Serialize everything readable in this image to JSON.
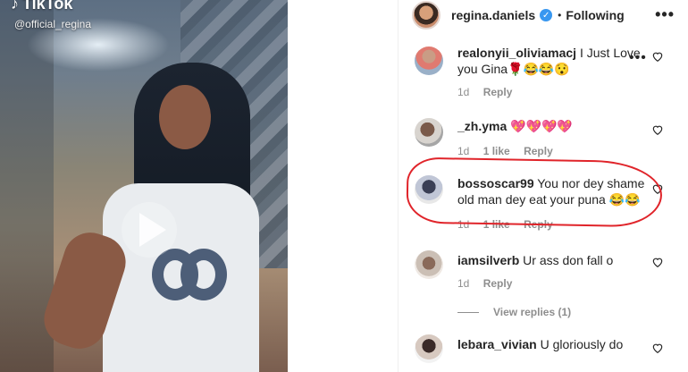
{
  "video": {
    "tiktok_label": "TikTok",
    "tiktok_user": "@official_regina"
  },
  "header": {
    "username": "regina.daniels",
    "separator": "•",
    "follow_status": "Following",
    "more": "•••"
  },
  "comments": [
    {
      "user": "realonyii_oliviamacj",
      "text": "I Just Love you Gina🌹😂😂😯",
      "time": "1d",
      "likes": "",
      "reply": "Reply"
    },
    {
      "user": "_zh.yma",
      "text": "💖💖💖💖",
      "time": "1d",
      "likes": "1 like",
      "reply": "Reply"
    },
    {
      "user": "bossoscar99",
      "text": "You nor dey shame old man dey eat your puna 😂😂",
      "time": "1d",
      "likes": "1 like",
      "reply": "Reply"
    },
    {
      "user": "iamsilverb",
      "text": "Ur ass don fall o",
      "time": "1d",
      "likes": "",
      "reply": "Reply"
    },
    {
      "user": "lebara_vivian",
      "text": "U gloriously do",
      "time": "",
      "likes": "",
      "reply": ""
    }
  ],
  "view_replies": "View replies (1)",
  "comment_more": "•••",
  "colors": {
    "verified": "#3897f0",
    "annotation": "#e0242a",
    "muted": "#8e8e8e"
  }
}
